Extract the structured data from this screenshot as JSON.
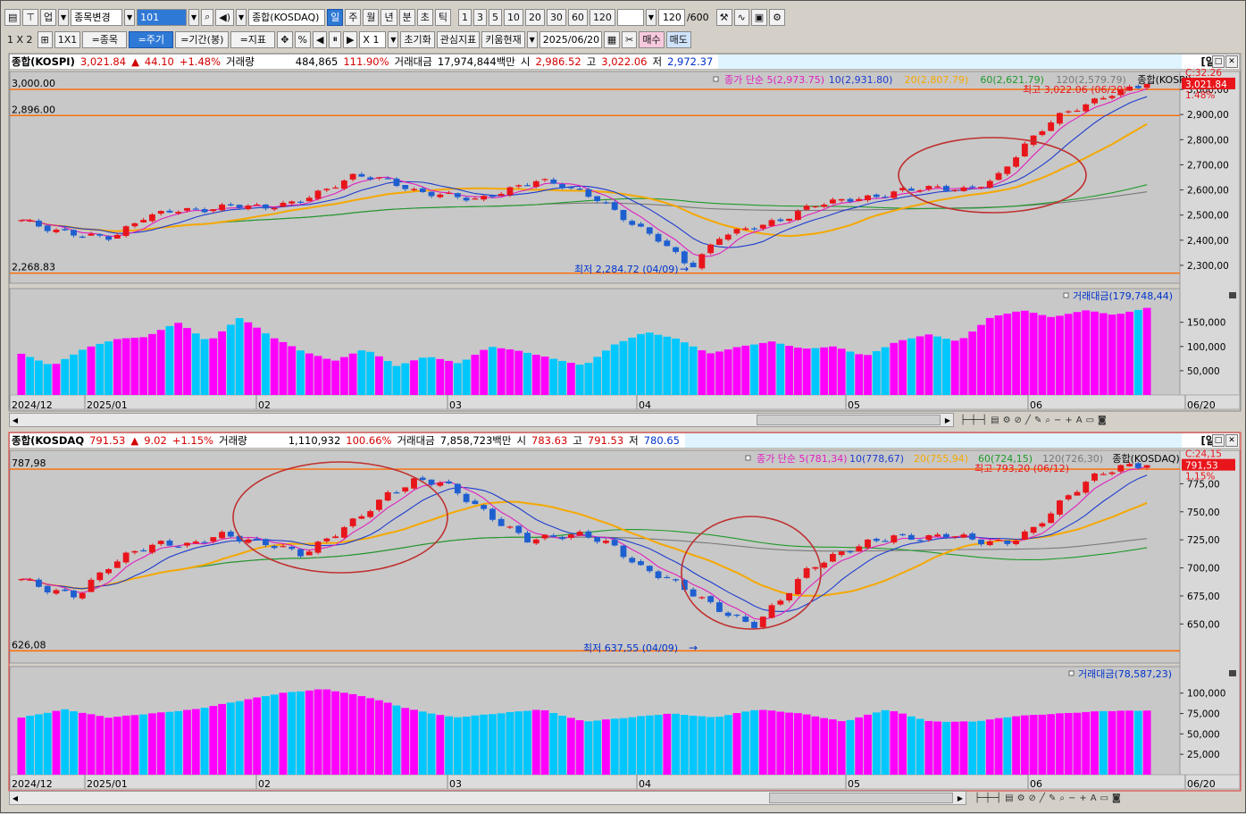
{
  "toolbar": {
    "row1": {
      "icons": [
        "layout-icon",
        "pin-icon"
      ],
      "up_label": "업",
      "change_label": "종목변경",
      "code_value": "101",
      "index_name": "종합(KOSDAQ)",
      "periods": [
        "일",
        "주",
        "월",
        "년",
        "분",
        "초",
        "틱"
      ],
      "period_selected": "일",
      "numbers": [
        "1",
        "3",
        "5",
        "10",
        "20",
        "30",
        "60",
        "120"
      ],
      "count_value": "120",
      "count_total": "/600"
    },
    "row2": {
      "layout": "1 X 2",
      "layout2": "1X1",
      "item_label": "=종목",
      "period_label": "=주기",
      "range_label": "=기간(봉)",
      "indicator_label": "=지표",
      "pct_label": "%",
      "zoom_label": "X 1",
      "reset_label": "초기화",
      "watch_label": "관심지표",
      "kiwoom_label": "키움현재",
      "date_value": "2025/06/20",
      "buy_label": "매수",
      "sell_label": "매도"
    }
  },
  "panels": [
    {
      "info": {
        "name": "종합(KOSPI)",
        "price": "3,021.84",
        "arrow": "▲",
        "change": "44.10",
        "pct": "+1.48%",
        "vol_label": "거래량",
        "vol": "484,865",
        "vol_pct": "111.90%",
        "amt_label": "거래대금",
        "amt": "17,974,844백만",
        "open_label": "시",
        "open": "2,986.52",
        "high_label": "고",
        "high": "3,022.06",
        "low_label": "저",
        "low": "2,972.37",
        "period_tag": "[일]"
      },
      "legend": {
        "main": "종가 단순 5(2,973.75)",
        "ma10": "10(2,931.80)",
        "ma20": "20(2,807.79)",
        "ma60": "60(2,621.79)",
        "ma120": "120(2,579.79)",
        "name": "종합(KOSPI)"
      },
      "annotations": {
        "hline_top": "3,000.00",
        "hline_mid": "2,896.00",
        "hline_low": "2,268.83",
        "high_note": "최고 3,022.06 (06/20)",
        "low_note": "최저 2,284.72 (04/09)",
        "cur_tag": "3,021.84",
        "pct_tag": "1.48%",
        "c_tag": "C:32.26"
      },
      "vol_legend": "거래대금(179,748,44)",
      "price_ticks": [
        "3,000,00",
        "2,900,00",
        "2,800,00",
        "2,700,00",
        "2,600,00",
        "2,500,00",
        "2,400,00",
        "2,300,00"
      ],
      "vol_ticks": [
        "150,000",
        "100,000",
        "50,000"
      ],
      "date_labels": [
        "2024/12",
        "2025/01",
        "02",
        "03",
        "04",
        "05",
        "06",
        "06/20"
      ]
    },
    {
      "info": {
        "name": "종합(KOSDAQ",
        "price": "791.53",
        "arrow": "▲",
        "change": "9.02",
        "pct": "+1.15%",
        "vol_label": "거래량",
        "vol": "1,110,932",
        "vol_pct": "100.66%",
        "amt_label": "거래대금",
        "amt": "7,858,723백만",
        "open_label": "시",
        "open": "783.63",
        "high_label": "고",
        "high": "791.53",
        "low_label": "저",
        "low": "780.65",
        "period_tag": "[일]"
      },
      "legend": {
        "main": "종가 단순 5(781,34)",
        "ma10": "10(778,67)",
        "ma20": "20(755,94)",
        "ma60": "60(724,15)",
        "ma120": "120(726,30)",
        "name": "종합(KOSDAQ)"
      },
      "annotations": {
        "hline_top": "787,98",
        "hline_low": "626,08",
        "high_note": "최고 793,20 (06/12)",
        "low_note": "최저 637,55 (04/09)",
        "cur_tag": "791,53",
        "pct_tag": "1,15%",
        "c_tag": "C:24,15"
      },
      "vol_legend": "거래대금(78,587,23)",
      "price_ticks": [
        "775,00",
        "750,00",
        "725,00",
        "700,00",
        "675,00",
        "650,00"
      ],
      "vol_ticks": [
        "100,000",
        "75,000",
        "50,000",
        "25,000"
      ],
      "date_labels": [
        "2024/12",
        "2025/01",
        "02",
        "03",
        "04",
        "05",
        "06",
        "06/20"
      ]
    }
  ],
  "colors": {
    "up": "#e8151b",
    "down": "#1e5fd0",
    "ma5": "#e020c0",
    "ma10": "#1e3cd0",
    "ma20": "#f5a800",
    "ma60": "#1f9a2a",
    "ma120": "#7a7a7a",
    "vol_up": "#ff00ff",
    "vol_down": "#00c8ff",
    "hline": "#ff6a00",
    "circle": "#c03030"
  },
  "chart_data": [
    {
      "type": "candlestick",
      "title": "종합(KOSPI)",
      "ylim": [
        2250,
        3050
      ],
      "x_range": [
        "2024-12",
        "2025-06-20"
      ],
      "ohlc_close_samples": [
        2480,
        2440,
        2420,
        2410,
        2490,
        2520,
        2520,
        2540,
        2530,
        2550,
        2600,
        2660,
        2640,
        2590,
        2580,
        2560,
        2600,
        2640,
        2610,
        2560,
        2470,
        2400,
        2290,
        2420,
        2450,
        2480,
        2540,
        2560,
        2570,
        2600,
        2610,
        2600,
        2640,
        2780,
        2890,
        2940,
        2990,
        3021.84
      ],
      "volume_samples_millions": [
        85000,
        60000,
        95000,
        115000,
        120000,
        150000,
        110000,
        160000,
        120000,
        90000,
        70000,
        95000,
        60000,
        80000,
        65000,
        100000,
        90000,
        75000,
        60000,
        105000,
        130000,
        115000,
        85000,
        100000,
        110000,
        95000,
        100000,
        80000,
        110000,
        125000,
        110000,
        160000,
        175000,
        160000,
        175000,
        165000,
        179748
      ]
    },
    {
      "type": "candlestick",
      "title": "종합(KOSDAQ)",
      "ylim": [
        620,
        800
      ],
      "x_range": [
        "2024-12",
        "2025-06-20"
      ],
      "ohlc_close_samples": [
        690,
        680,
        675,
        700,
        715,
        722,
        720,
        730,
        725,
        720,
        712,
        728,
        745,
        765,
        778,
        776,
        758,
        740,
        725,
        728,
        730,
        720,
        700,
        690,
        675,
        660,
        648,
        672,
        700,
        712,
        722,
        728,
        726,
        730,
        724,
        722,
        735,
        760,
        780,
        790,
        791.53
      ],
      "volume_samples_millions": [
        70000,
        80000,
        70000,
        75000,
        80000,
        90000,
        100000,
        105000,
        95000,
        80000,
        70000,
        75000,
        80000,
        65000,
        70000,
        75000,
        70000,
        80000,
        75000,
        65000,
        80000,
        65000,
        65000,
        72000,
        75000,
        78000,
        78587
      ]
    }
  ]
}
